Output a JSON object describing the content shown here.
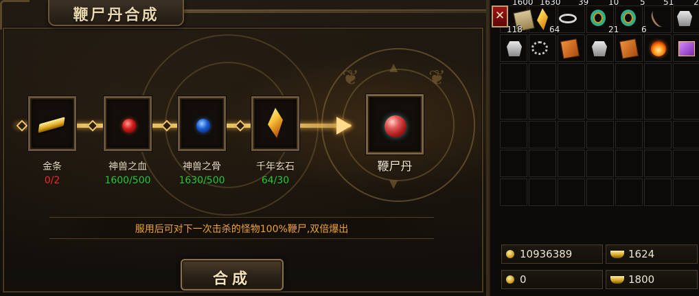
{
  "panel": {
    "title": "鞭尸丹合成",
    "materials": [
      {
        "name": "金条",
        "count": "0/2",
        "status": "insufficient",
        "icon": "gold-bar-icon"
      },
      {
        "name": "神兽之血",
        "count": "1600/500",
        "status": "sufficient",
        "icon": "red-orb-icon"
      },
      {
        "name": "神兽之骨",
        "count": "1630/500",
        "status": "sufficient",
        "icon": "blue-orb-icon"
      },
      {
        "name": "千年玄石",
        "count": "64/30",
        "status": "sufficient",
        "icon": "crystal-icon"
      }
    ],
    "result": {
      "name": "鞭尸丹",
      "icon": "red-speckled-orb-icon"
    },
    "description": "服用后可对下一次击杀的怪物100%鞭尸,双倍爆出",
    "synth_button": "合成"
  },
  "bag": {
    "close_label": "✕",
    "top_row_partial_counts": [
      "1600",
      "1630",
      "39",
      "10",
      "5",
      "51",
      "2"
    ],
    "row1": [
      {
        "icon": "scroll-icon",
        "count": "118"
      },
      {
        "icon": "crystal-icon",
        "count": "64"
      },
      {
        "icon": "bracelet-icon",
        "count": ""
      },
      {
        "icon": "green-gold-ring-icon",
        "count": "21"
      },
      {
        "icon": "green-gold-ring-icon",
        "count": "6"
      },
      {
        "icon": "bow-icon",
        "count": ""
      },
      {
        "icon": "armor-icon",
        "count": ""
      }
    ],
    "row2": [
      {
        "icon": "armor-icon"
      },
      {
        "icon": "necklace-icon"
      },
      {
        "icon": "orange-book-icon"
      },
      {
        "icon": "armor-icon"
      },
      {
        "icon": "orange-book-icon"
      },
      {
        "icon": "flame-orb-icon"
      },
      {
        "icon": "purple-gift-icon"
      }
    ],
    "currency": {
      "gold": "10936389",
      "ingot": "1624",
      "bound_gold": "0",
      "bound_ingot": "1800"
    }
  },
  "colors": {
    "count_insufficient": "#ff2a2a",
    "count_sufficient": "#26d12e",
    "description": "#f0a52c"
  }
}
